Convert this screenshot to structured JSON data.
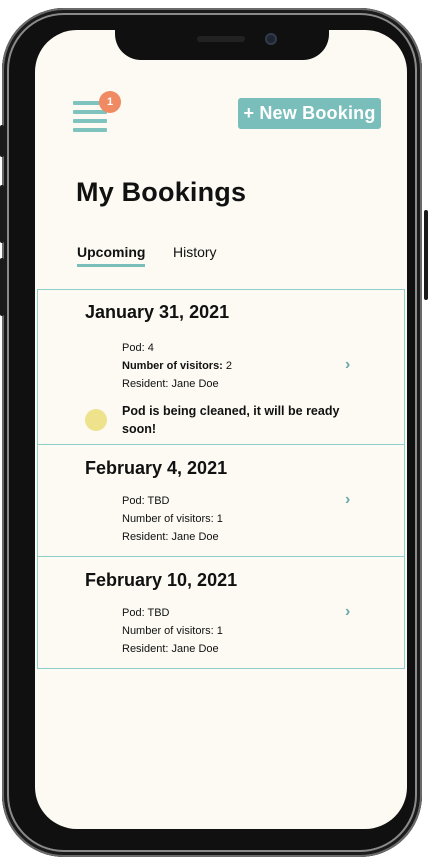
{
  "header": {
    "menu_badge_count": "1",
    "new_booking_label": "+ New Booking"
  },
  "page": {
    "title": "My Bookings"
  },
  "tabs": [
    {
      "label": "Upcoming",
      "active": true
    },
    {
      "label": "History",
      "active": false
    }
  ],
  "bookings": [
    {
      "date": "January 31, 2021",
      "pod_label": "Pod:",
      "pod_value": "4",
      "visitors_label": "Number of visitors:",
      "visitors_value": "2",
      "resident_label": "Resident:",
      "resident_value": "Jane Doe",
      "status": "Pod is being cleaned, it will be ready soon!",
      "status_color": "#eee28c"
    },
    {
      "date": "February 4, 2021",
      "pod_label": "Pod:",
      "pod_value": "TBD",
      "visitors_label": "Number of visitors:",
      "visitors_value": "1",
      "resident_label": "Resident:",
      "resident_value": "Jane Doe"
    },
    {
      "date": "February 10, 2021",
      "pod_label": "Pod:",
      "pod_value": "TBD",
      "visitors_label": "Number of visitors:",
      "visitors_value": "1",
      "resident_label": "Resident:",
      "resident_value": "Jane Doe"
    }
  ],
  "icons": {
    "menu": "hamburger-menu-icon",
    "chevron": "chevron-right-icon"
  },
  "colors": {
    "accent": "#79bebb",
    "badge": "#ef8a62",
    "background": "#fcfaf3",
    "status_cleaning": "#eee28c"
  }
}
